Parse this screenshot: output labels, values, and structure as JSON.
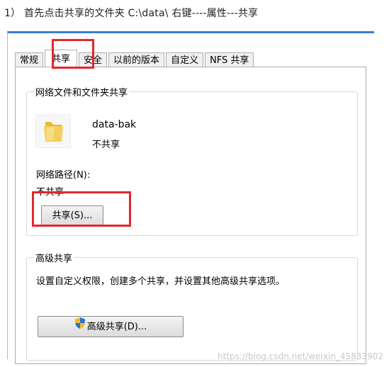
{
  "instruction": "1） 首先点击共享的文件夹 C:\\data\\   右键----属性---共享",
  "tabs": [
    {
      "label": "常规"
    },
    {
      "label": "共享"
    },
    {
      "label": "安全"
    },
    {
      "label": "以前的版本"
    },
    {
      "label": "自定义"
    },
    {
      "label": "NFS 共享"
    }
  ],
  "network_sharing": {
    "title": "网络文件和文件夹共享",
    "folder_name": "data-bak",
    "folder_status": "不共享",
    "path_label": "网络路径(N):",
    "path_value": "不共享",
    "share_button": "共享(S)..."
  },
  "advanced_sharing": {
    "title": "高级共享",
    "description": "设置自定义权限，创建多个共享，并设置其他高级共享选项。",
    "button": "高级共享(D)..."
  },
  "colors": {
    "highlight": "#e3272d",
    "title_bar": "#3b7fd1",
    "folder": "#f0c44c"
  },
  "watermark": "https://blog.csdn.net/weixin_45833902"
}
